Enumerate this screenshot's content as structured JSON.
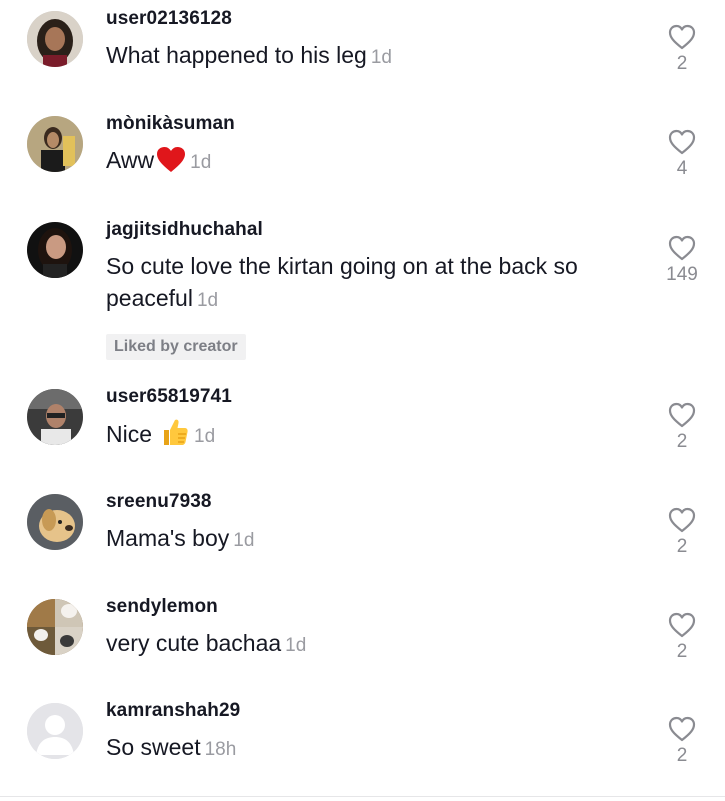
{
  "comments": [
    {
      "username": "user02136128",
      "text": "What happened to his leg",
      "time": "1d",
      "likes": "2",
      "avatar": "woman-curly-hair",
      "emoji": ""
    },
    {
      "username": "mònikàsuman",
      "text": "Aww",
      "time": "1d",
      "likes": "4",
      "avatar": "woman-yellow",
      "emoji": "red-heart"
    },
    {
      "username": "jagjitsidhuchahal",
      "text": "So cute love the kirtan going on at the back so peaceful",
      "time": "1d",
      "likes": "149",
      "avatar": "woman-dark-hair",
      "emoji": "",
      "badge": "Liked by creator"
    },
    {
      "username": "user65819741",
      "text": "Nice",
      "time": "1d",
      "likes": "2",
      "avatar": "man-in-car",
      "emoji": "thumbs-up"
    },
    {
      "username": "sreenu7938",
      "text": "Mama's boy",
      "time": "1d",
      "likes": "2",
      "avatar": "golden-dog",
      "emoji": ""
    },
    {
      "username": "sendylemon",
      "text": "very cute bachaa",
      "time": "1d",
      "likes": "2",
      "avatar": "puppies-collage",
      "emoji": ""
    },
    {
      "username": "kamranshah29",
      "text": "So sweet",
      "time": "18h",
      "likes": "2",
      "avatar": "default-avatar",
      "emoji": ""
    }
  ],
  "colors": {
    "text": "#161823",
    "muted": "#9a9ba1",
    "badge_bg": "#f1f1f2"
  }
}
